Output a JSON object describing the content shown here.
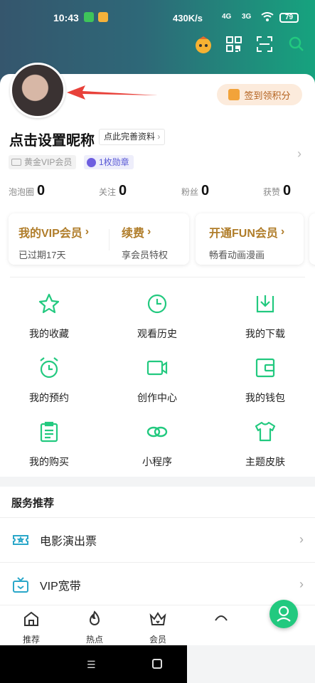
{
  "status_bar": {
    "time": "10:43",
    "network_speed": "430K/s",
    "signal1": "4G",
    "signal2": "3G",
    "battery": "79"
  },
  "profile": {
    "checkin_label": "签到领积分",
    "nickname": "点击设置昵称",
    "complete_link": "点此完善资料",
    "vip_badge": "黄金VIP会员",
    "medal_badge": "1枚勋章"
  },
  "stats": [
    {
      "label": "泡泡圈",
      "value": "0"
    },
    {
      "label": "关注",
      "value": "0"
    },
    {
      "label": "粉丝",
      "value": "0"
    },
    {
      "label": "获赞",
      "value": "0"
    }
  ],
  "vip_cards": {
    "my_vip_title": "我的VIP会员",
    "my_vip_sub": "已过期17天",
    "renew_title": "续费",
    "renew_sub": "享会员特权",
    "fun_title": "开通FUN会员",
    "fun_sub": "畅看动画漫画"
  },
  "grid": [
    {
      "label": "我的收藏",
      "icon": "star-icon"
    },
    {
      "label": "观看历史",
      "icon": "clock-icon"
    },
    {
      "label": "我的下载",
      "icon": "download-icon"
    },
    {
      "label": "我的预约",
      "icon": "alarm-icon"
    },
    {
      "label": "创作中心",
      "icon": "video-camera-icon"
    },
    {
      "label": "我的钱包",
      "icon": "wallet-icon"
    },
    {
      "label": "我的购买",
      "icon": "receipt-icon"
    },
    {
      "label": "小程序",
      "icon": "link-icon"
    },
    {
      "label": "主题皮肤",
      "icon": "tshirt-icon"
    }
  ],
  "services": {
    "title": "服务推荐",
    "items": [
      {
        "label": "电影演出票",
        "icon": "ticket-icon"
      },
      {
        "label": "VIP宽带",
        "icon": "broadband-icon"
      }
    ]
  },
  "bottom_nav": [
    {
      "label": "推荐",
      "icon": "home-icon"
    },
    {
      "label": "热点",
      "icon": "flame-icon"
    },
    {
      "label": "会员",
      "icon": "crown-icon"
    }
  ],
  "colors": {
    "accent_green": "#22c97f",
    "vip_gold": "#b07d2a",
    "arrow_red": "#e8413a"
  }
}
